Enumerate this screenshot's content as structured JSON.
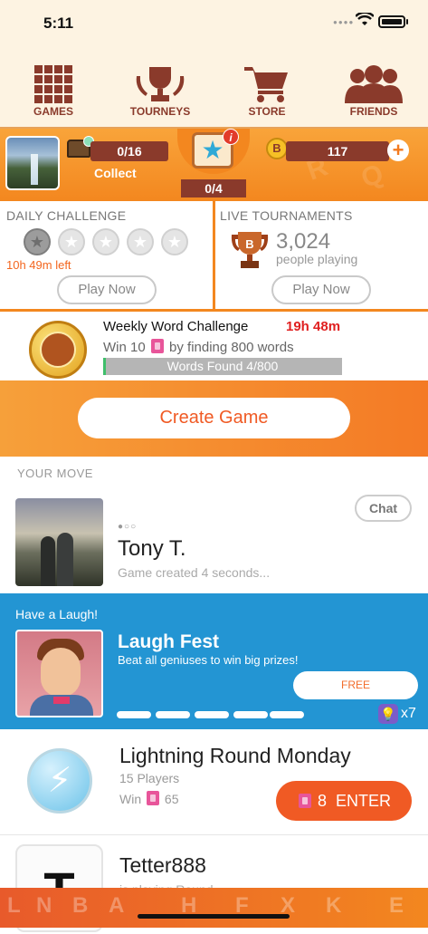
{
  "status": {
    "time": "5:11"
  },
  "nav": {
    "items": [
      {
        "label": "GAMES",
        "icon": "grid-icon"
      },
      {
        "label": "TOURNEYS",
        "icon": "trophy-icon"
      },
      {
        "label": "STORE",
        "icon": "cart-icon"
      },
      {
        "label": "FRIENDS",
        "icon": "people-icon"
      }
    ]
  },
  "stats": {
    "chest_progress": "0/16",
    "collect_label": "Collect",
    "star_progress": "0/4",
    "coin_letter": "B",
    "coins": "117"
  },
  "daily": {
    "title": "DAILY CHALLENGE",
    "time_left": "10h 49m left",
    "play_label": "Play Now",
    "stars_completed": 1,
    "stars_total": 5
  },
  "live": {
    "title": "LIVE TOURNAMENTS",
    "trophy_letter": "B",
    "count": "3,024",
    "count_label": "people playing",
    "play_label": "Play Now"
  },
  "weekly": {
    "title": "Weekly Word Challenge",
    "time": "19h 48m",
    "win_prefix": "Win 10",
    "win_suffix": "by finding 800 words",
    "progress_label": "Words Found 4/800",
    "progress_fraction": 0.005
  },
  "create": {
    "label": "Create Game"
  },
  "your_move": {
    "label": "YOUR MOVE"
  },
  "tony": {
    "chat_label": "Chat",
    "name": "Tony T.",
    "sub": "Game created 4 seconds..."
  },
  "laugh": {
    "header": "Have a Laugh!",
    "title": "Laugh Fest",
    "subtitle": "Beat all geniuses to win big prizes!",
    "free_label": "FREE",
    "hints": "x7"
  },
  "lightning": {
    "title": "Lightning Round Monday",
    "players": "15 Players",
    "win_prefix": "Win",
    "win_amount": "65",
    "enter_cost": "8",
    "enter_label": "ENTER"
  },
  "tetter": {
    "letter": "T",
    "name": "Tetter888",
    "sub": "is playing Round..."
  },
  "colors": {
    "accent": "#f3871f",
    "brand_brown": "#8a3a2b",
    "blue": "#2395d3",
    "button_orange": "#f05a24"
  }
}
